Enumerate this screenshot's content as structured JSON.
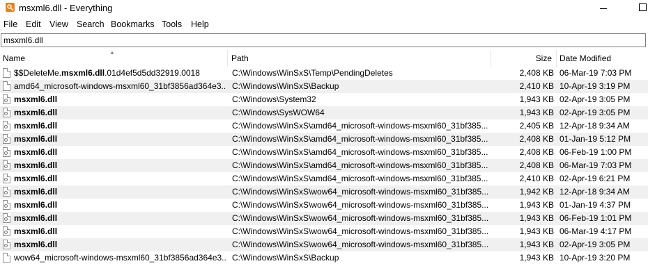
{
  "window": {
    "title": "msxml6.dll - Everything"
  },
  "menu": [
    "File",
    "Edit",
    "View",
    "Search",
    "Bookmarks",
    "Tools",
    "Help"
  ],
  "search": {
    "value": "msxml6.dll"
  },
  "columns": {
    "name": "Name",
    "path": "Path",
    "size": "Size",
    "date": "Date Modified"
  },
  "rows": [
    {
      "name_pre": "$$DeleteMe.",
      "name_bold": "msxml6.dll",
      "name_post": ".01d4ef5d5dd32919.0018",
      "icon": "file-icon",
      "path": "C:\\Windows\\WinSxS\\Temp\\PendingDeletes",
      "size": "2,408 KB",
      "date": "06-Mar-19 7:03 PM"
    },
    {
      "name_pre": "amd64_microsoft-windows-msxml60_31bf3856ad364e3...",
      "name_bold": "",
      "name_post": "",
      "icon": "file-icon",
      "path": "C:\\Windows\\WinSxS\\Backup",
      "size": "2,410 KB",
      "date": "10-Apr-19 3:19 PM"
    },
    {
      "name_pre": "",
      "name_bold": "msxml6.dll",
      "name_post": "",
      "icon": "dll-file-icon",
      "path": "C:\\Windows\\System32",
      "size": "1,943 KB",
      "date": "02-Apr-19 3:05 PM"
    },
    {
      "name_pre": "",
      "name_bold": "msxml6.dll",
      "name_post": "",
      "icon": "dll-file-icon",
      "path": "C:\\Windows\\SysWOW64",
      "size": "1,943 KB",
      "date": "02-Apr-19 3:05 PM"
    },
    {
      "name_pre": "",
      "name_bold": "msxml6.dll",
      "name_post": "",
      "icon": "dll-file-icon",
      "path": "C:\\Windows\\WinSxS\\amd64_microsoft-windows-msxml60_31bf385...",
      "size": "2,405 KB",
      "date": "12-Apr-18 9:34 AM"
    },
    {
      "name_pre": "",
      "name_bold": "msxml6.dll",
      "name_post": "",
      "icon": "dll-file-icon",
      "path": "C:\\Windows\\WinSxS\\amd64_microsoft-windows-msxml60_31bf385...",
      "size": "2,408 KB",
      "date": "01-Jan-19 5:12 PM"
    },
    {
      "name_pre": "",
      "name_bold": "msxml6.dll",
      "name_post": "",
      "icon": "dll-file-icon",
      "path": "C:\\Windows\\WinSxS\\amd64_microsoft-windows-msxml60_31bf385...",
      "size": "2,408 KB",
      "date": "06-Feb-19 1:00 PM"
    },
    {
      "name_pre": "",
      "name_bold": "msxml6.dll",
      "name_post": "",
      "icon": "dll-file-icon",
      "path": "C:\\Windows\\WinSxS\\amd64_microsoft-windows-msxml60_31bf385...",
      "size": "2,408 KB",
      "date": "06-Mar-19 7:03 PM"
    },
    {
      "name_pre": "",
      "name_bold": "msxml6.dll",
      "name_post": "",
      "icon": "dll-file-icon",
      "path": "C:\\Windows\\WinSxS\\amd64_microsoft-windows-msxml60_31bf385...",
      "size": "2,410 KB",
      "date": "02-Apr-19 6:21 PM"
    },
    {
      "name_pre": "",
      "name_bold": "msxml6.dll",
      "name_post": "",
      "icon": "dll-file-icon",
      "path": "C:\\Windows\\WinSxS\\wow64_microsoft-windows-msxml60_31bf385...",
      "size": "1,942 KB",
      "date": "12-Apr-18 9:34 AM"
    },
    {
      "name_pre": "",
      "name_bold": "msxml6.dll",
      "name_post": "",
      "icon": "dll-file-icon",
      "path": "C:\\Windows\\WinSxS\\wow64_microsoft-windows-msxml60_31bf385...",
      "size": "1,943 KB",
      "date": "01-Jan-19 4:37 PM"
    },
    {
      "name_pre": "",
      "name_bold": "msxml6.dll",
      "name_post": "",
      "icon": "dll-file-icon",
      "path": "C:\\Windows\\WinSxS\\wow64_microsoft-windows-msxml60_31bf385...",
      "size": "1,943 KB",
      "date": "06-Feb-19 1:01 PM"
    },
    {
      "name_pre": "",
      "name_bold": "msxml6.dll",
      "name_post": "",
      "icon": "dll-file-icon",
      "path": "C:\\Windows\\WinSxS\\wow64_microsoft-windows-msxml60_31bf385...",
      "size": "1,943 KB",
      "date": "06-Mar-19 4:17 PM"
    },
    {
      "name_pre": "",
      "name_bold": "msxml6.dll",
      "name_post": "",
      "icon": "dll-file-icon",
      "path": "C:\\Windows\\WinSxS\\wow64_microsoft-windows-msxml60_31bf385...",
      "size": "1,943 KB",
      "date": "02-Apr-19 3:05 PM"
    },
    {
      "name_pre": "wow64_microsoft-windows-msxml60_31bf3856ad364e3...",
      "name_bold": "",
      "name_post": "",
      "icon": "file-icon",
      "path": "C:\\Windows\\WinSxS\\Backup",
      "size": "1,943 KB",
      "date": "10-Apr-19 3:20 PM"
    }
  ],
  "colors": {
    "alt_row": "#f0f0f0",
    "app_icon": "#e8821e"
  }
}
